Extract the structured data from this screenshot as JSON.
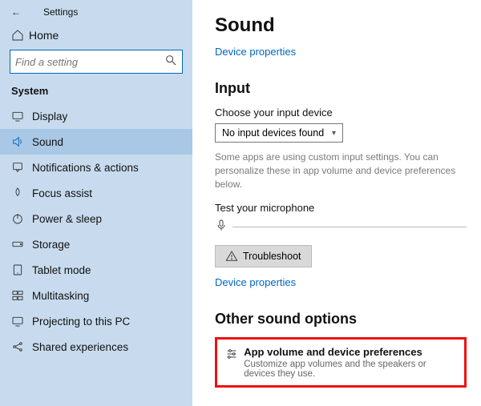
{
  "header": {
    "back_icon": "←",
    "title": "Settings"
  },
  "home": {
    "label": "Home"
  },
  "search": {
    "placeholder": "Find a setting"
  },
  "section": "System",
  "nav": {
    "display": "Display",
    "sound": "Sound",
    "notifications": "Notifications & actions",
    "focus": "Focus assist",
    "power": "Power & sleep",
    "storage": "Storage",
    "tablet": "Tablet mode",
    "multitasking": "Multitasking",
    "projecting": "Projecting to this PC",
    "shared": "Shared experiences"
  },
  "main": {
    "title": "Sound",
    "device_properties": "Device properties",
    "input_heading": "Input",
    "choose_label": "Choose your input device",
    "dropdown_value": "No input devices found",
    "custom_desc": "Some apps are using custom input settings. You can personalize these in app volume and device preferences below.",
    "test_label": "Test your microphone",
    "troubleshoot": "Troubleshoot",
    "device_properties2": "Device properties",
    "other_heading": "Other sound options",
    "app_volume_title": "App volume and device preferences",
    "app_volume_sub": "Customize app volumes and the speakers or devices they use."
  }
}
